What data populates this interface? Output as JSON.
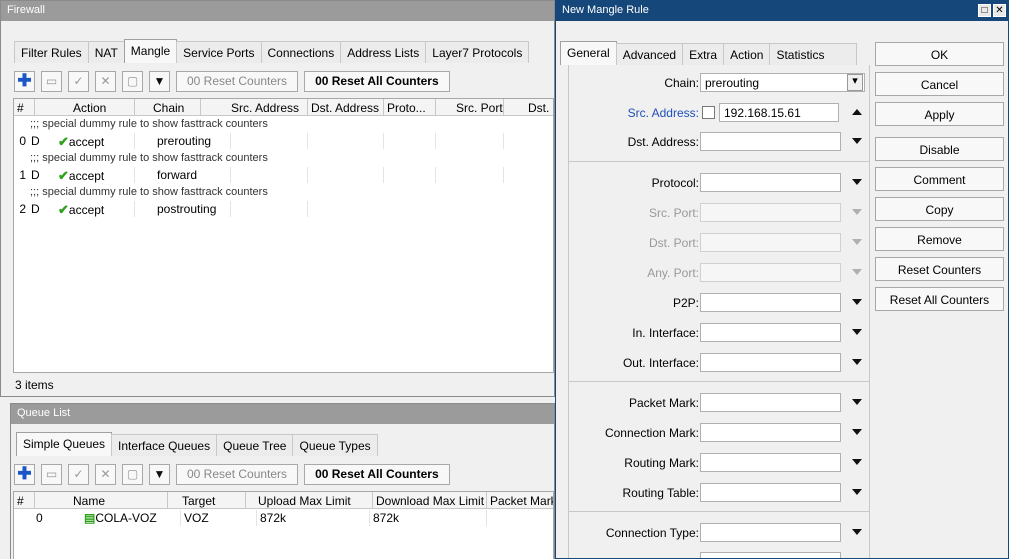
{
  "firewall": {
    "title": "Firewall",
    "tabs": [
      "Filter Rules",
      "NAT",
      "Mangle",
      "Service Ports",
      "Connections",
      "Address Lists",
      "Layer7 Protocols"
    ],
    "reset_counters": "00 Reset Counters",
    "reset_all_counters": "00 Reset All Counters",
    "columns": [
      "#",
      "Action",
      "Chain",
      "Src. Address",
      "Dst. Address",
      "Proto...",
      "Src. Port",
      "Dst. Port"
    ],
    "comment": ";;; special dummy rule to show fasttrack counters",
    "rows": [
      {
        "num": "0",
        "flag": "D",
        "action": "accept",
        "chain": "prerouting"
      },
      {
        "num": "1",
        "flag": "D",
        "action": "accept",
        "chain": "forward"
      },
      {
        "num": "2",
        "flag": "D",
        "action": "accept",
        "chain": "postrouting"
      }
    ],
    "status": "3 items"
  },
  "queue": {
    "title": "Queue List",
    "tabs": [
      "Simple Queues",
      "Interface Queues",
      "Queue Tree",
      "Queue Types"
    ],
    "reset_counters": "00 Reset Counters",
    "reset_all_counters": "00 Reset All Counters",
    "columns": [
      "#",
      "Name",
      "Target",
      "Upload Max Limit",
      "Download Max Limit",
      "Packet Marks"
    ],
    "rows": [
      {
        "num": "0",
        "name": "COLA-VOZ",
        "target": "VOZ",
        "upload": "872k",
        "download": "872k"
      }
    ]
  },
  "mangle_rule": {
    "title": "New Mangle Rule",
    "tabs": [
      "General",
      "Advanced",
      "Extra",
      "Action",
      "Statistics"
    ],
    "chain_label": "Chain:",
    "chain_value": "prerouting",
    "src_address_label": "Src. Address:",
    "src_address_value": "192.168.15.61",
    "dst_address_label": "Dst. Address:",
    "protocol_label": "Protocol:",
    "src_port_label": "Src. Port:",
    "dst_port_label": "Dst. Port:",
    "any_port_label": "Any. Port:",
    "p2p_label": "P2P:",
    "in_interface_label": "In. Interface:",
    "out_interface_label": "Out. Interface:",
    "packet_mark_label": "Packet Mark:",
    "connection_mark_label": "Connection Mark:",
    "routing_mark_label": "Routing Mark:",
    "routing_table_label": "Routing Table:",
    "connection_type_label": "Connection Type:",
    "buttons": [
      "OK",
      "Cancel",
      "Apply",
      "Disable",
      "Comment",
      "Copy",
      "Remove",
      "Reset Counters",
      "Reset All Counters"
    ]
  }
}
